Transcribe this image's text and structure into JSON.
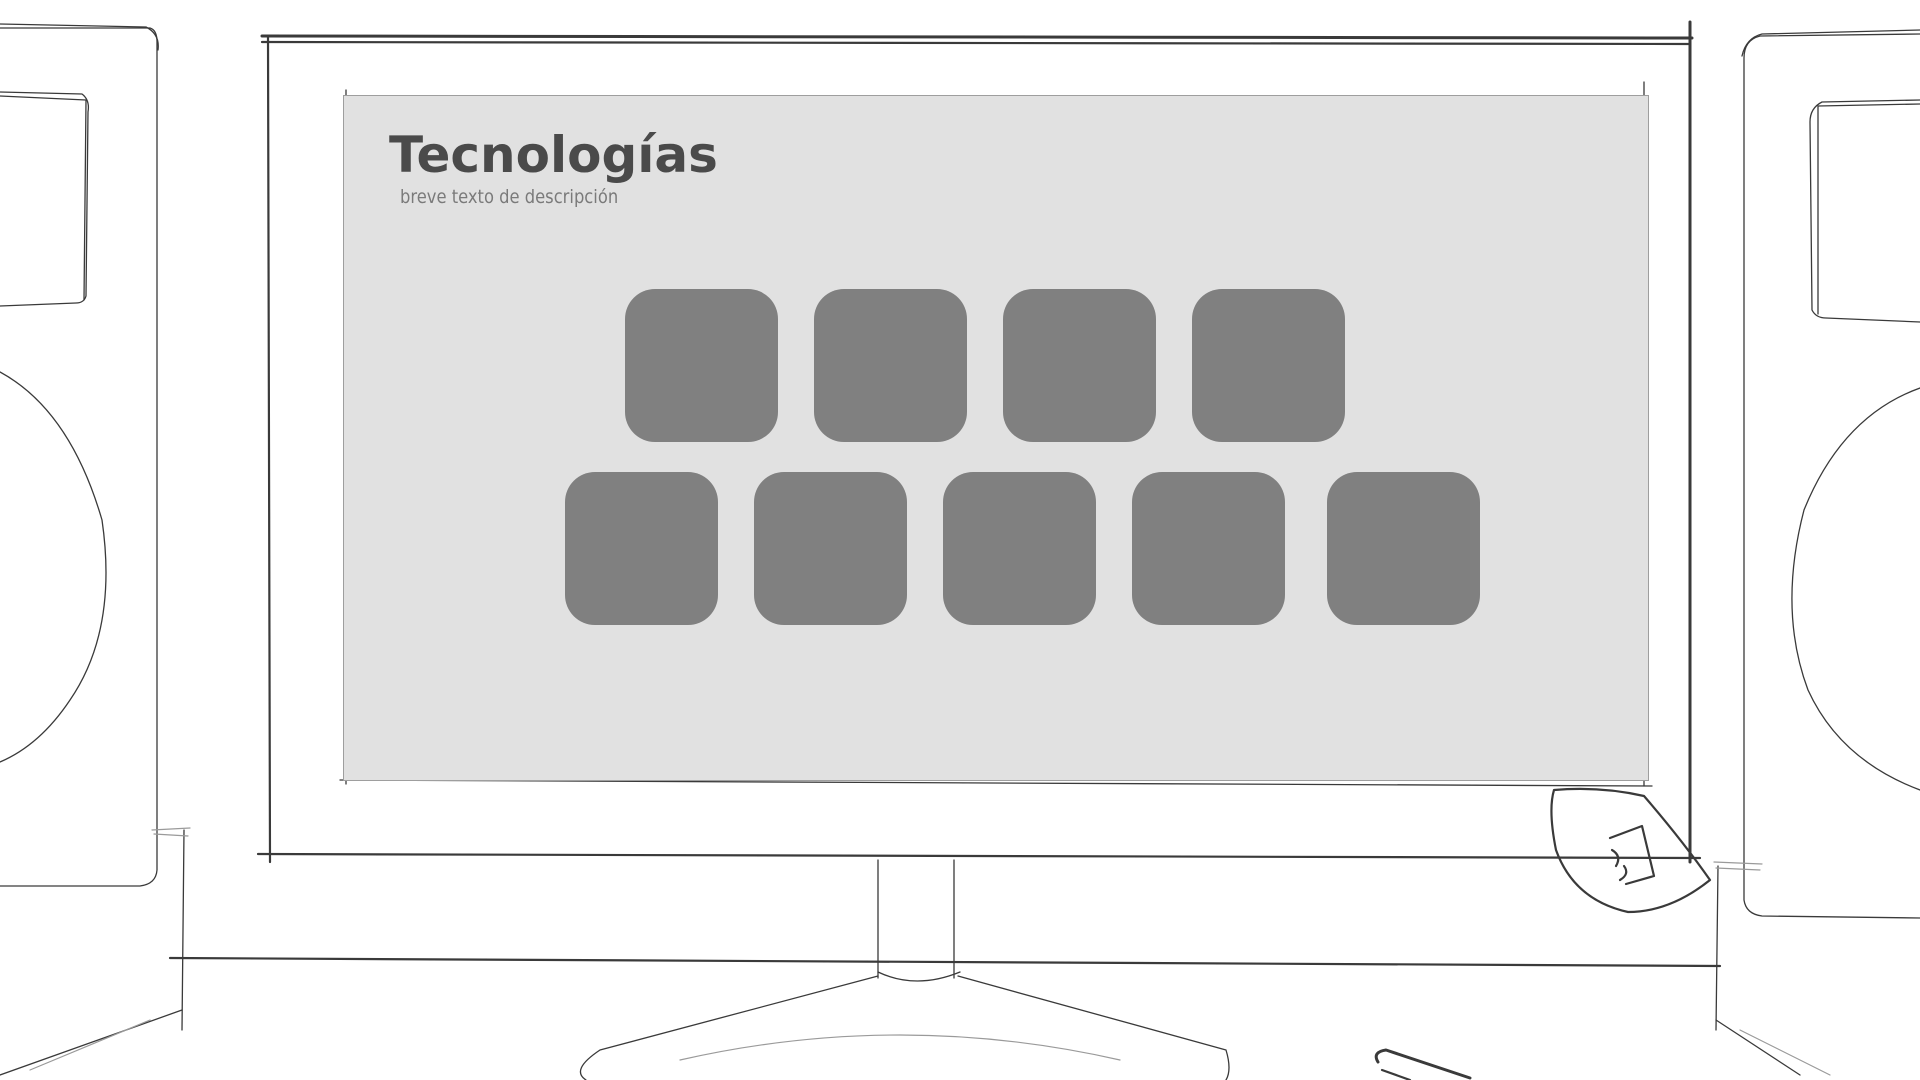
{
  "section": {
    "title": "Tecnologías",
    "description": "breve texto de descripción"
  },
  "tiles": {
    "row1": [
      "",
      "",
      "",
      ""
    ],
    "row2": [
      "",
      "",
      "",
      "",
      ""
    ]
  },
  "colors": {
    "screen_background": "#e1e1e1",
    "tile": "#808080",
    "title_text": "#4a4a4a",
    "description_text": "#7a7a7a",
    "sketch_line": "#3a3a3a"
  },
  "icons": [
    "monitor-sketch",
    "left-speaker-sketch",
    "right-speaker-sketch",
    "sticker-sketch",
    "pen-sketch"
  ]
}
